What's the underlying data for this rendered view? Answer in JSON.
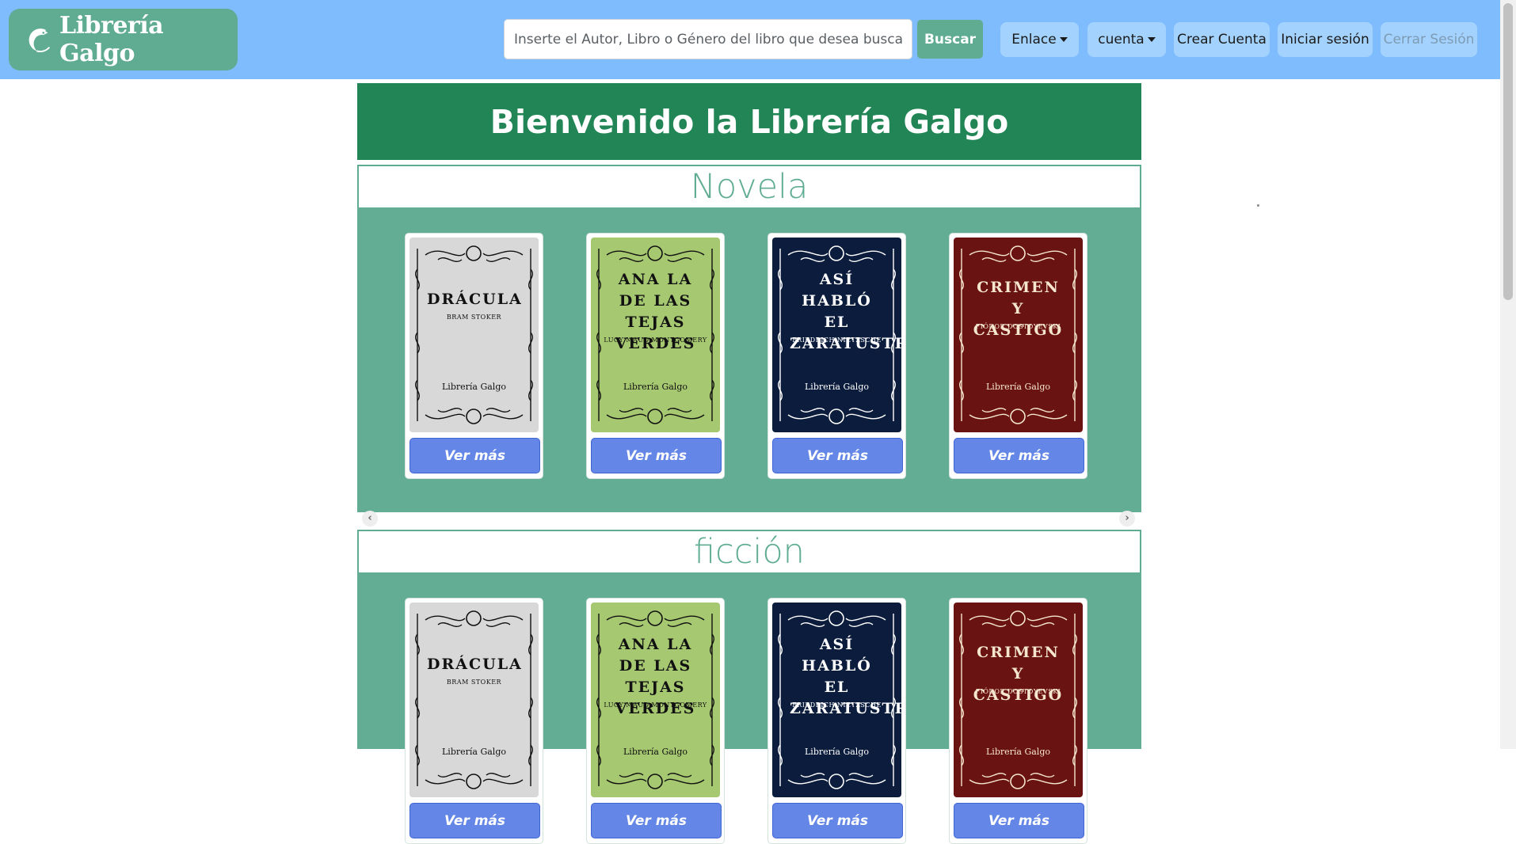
{
  "brand": {
    "name": "Librería Galgo",
    "icon": "galgo-dog-icon"
  },
  "search": {
    "placeholder": "Inserte el Autor, Libro o Género del libro que desea buscar",
    "value": "",
    "button_label": "Buscar"
  },
  "nav": {
    "enlace_label": "Enlace",
    "cuenta_label": "cuenta",
    "crear_cuenta_label": "Crear Cuenta",
    "iniciar_sesion_label": "Iniciar sesión",
    "cerrar_sesion_label": "Cerrar Sesión"
  },
  "welcome": {
    "title": "Bienvenido la Librería Galgo"
  },
  "sections": [
    {
      "title": "Novela"
    },
    {
      "title": "ficción"
    }
  ],
  "books": [
    {
      "title": "DRÁCULA",
      "author": "BRAM STOKER",
      "publisher": "Librería Galgo",
      "cover_color": "#d8d8d8",
      "text_color": "#111111"
    },
    {
      "title": "ANA LA DE LAS TEJAS VERDES",
      "author": "LUCY MAUD MONTGOMERY",
      "publisher": "Librería Galgo",
      "cover_color": "#a6c870",
      "text_color": "#111111"
    },
    {
      "title": "ASÍ HABLÓ EL ZARATUSTRA",
      "author": "FRIEDRICH NIETZSCHE",
      "publisher": "Librería Galgo",
      "cover_color": "#0b1c3d",
      "text_color": "#ffffff"
    },
    {
      "title": "CRIMEN Y CASTIGO",
      "author": "FIÓDOR DOSTOYEVSKI",
      "publisher": "Librería Galgo",
      "cover_color": "#6a1313",
      "text_color": "#f5e6d0"
    }
  ],
  "card_button_label": "Ver más",
  "carousel": {
    "prev_icon": "chevron-left-icon",
    "next_icon": "chevron-right-icon"
  },
  "colors": {
    "navbar": "#7fbcfd",
    "brand_bg": "#5fac93",
    "welcome_bg": "#218556",
    "section_bg": "#63ad95",
    "button_blue": "#6486e7"
  }
}
